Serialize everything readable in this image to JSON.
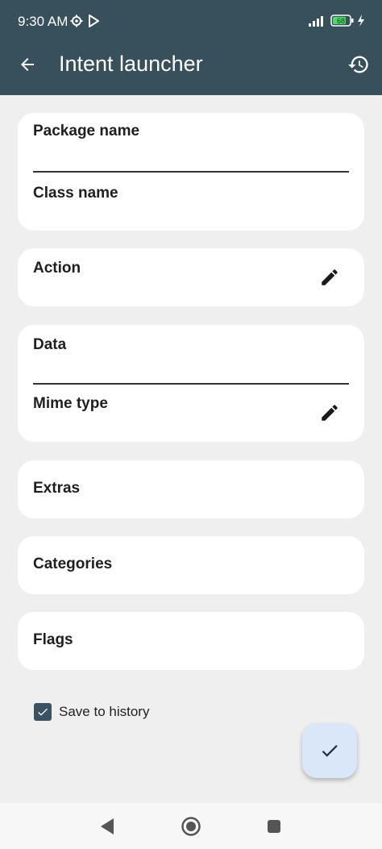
{
  "status_bar": {
    "time": "9:30 AM",
    "battery_level": "68"
  },
  "toolbar": {
    "title": "Intent launcher"
  },
  "fields": {
    "package_name": "Package name",
    "class_name": "Class name",
    "action": "Action",
    "data": "Data",
    "mime_type": "Mime type",
    "extras": "Extras",
    "categories": "Categories",
    "flags": "Flags"
  },
  "options": {
    "save_to_history_label": "Save to history",
    "save_to_history_checked": true
  },
  "colors": {
    "app_bar": "#37505c",
    "background": "#efeff0",
    "card": "#ffffff",
    "checkbox": "#3a5261",
    "fab": "#d9e7f8",
    "battery": "#4cd964"
  },
  "icons": {
    "back": "arrow-left-icon",
    "history": "history-icon",
    "edit": "pencil-icon",
    "fab": "check-icon"
  }
}
